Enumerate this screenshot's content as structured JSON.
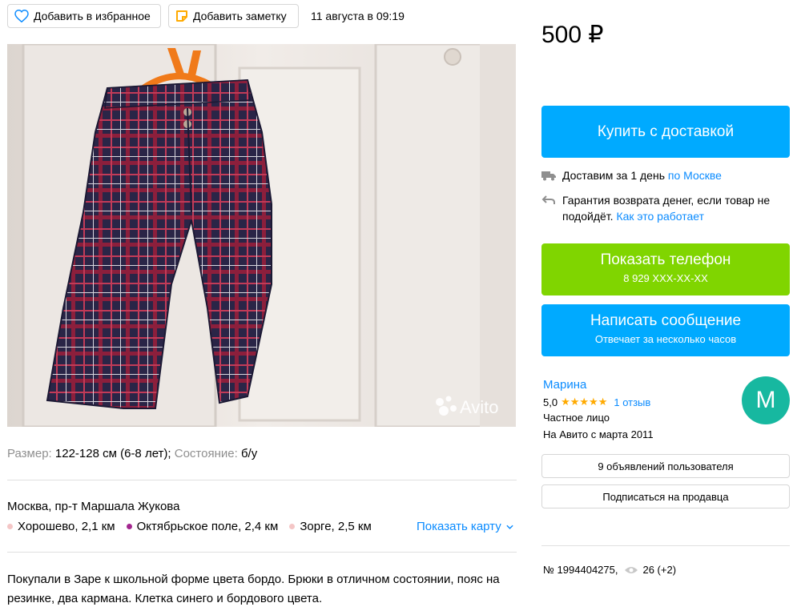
{
  "top_bar": {
    "favorite_label": "Добавить в избранное",
    "note_label": "Добавить заметку",
    "date": "11 августа в 09:19"
  },
  "photo": {
    "watermark": "Avito"
  },
  "details": {
    "size_label": "Размер:",
    "size_value": "122-128 см (6-8 лет);",
    "condition_label": "Состояние:",
    "condition_value": "б/у"
  },
  "location": {
    "address": "Москва, пр-т Маршала Жукова",
    "stations": [
      {
        "name": "Хорошево, 2,1 км",
        "color": "#f4c6c6"
      },
      {
        "name": "Октябрьское поле, 2,4 км",
        "color": "#a3268f"
      },
      {
        "name": "Зорге, 2,5 км",
        "color": "#f4c6c6"
      }
    ],
    "show_map": "Показать карту"
  },
  "description": "Покупали в Заре к школьной форме цвета бордо. Брюки в отличном состоянии, пояс на резинке, два кармана. Клетка синего и бордового цвета.",
  "price": "500 ₽",
  "buy": {
    "label": "Купить с доставкой"
  },
  "delivery": {
    "text": "Доставим за 1 день",
    "link": "по Москве"
  },
  "guarantee": {
    "text": "Гарантия возврата денег, если товар не подойдёт.",
    "link": "Как это работает"
  },
  "phone": {
    "label": "Показать телефон",
    "number": "8 929 XXX-XX-XX"
  },
  "message": {
    "label": "Написать сообщение",
    "sub": "Отвечает за несколько часов"
  },
  "seller": {
    "name": "Марина",
    "rating": "5,0",
    "stars": "★★★★★",
    "reviews": "1 отзыв",
    "type": "Частное лицо",
    "since": "На Авито с марта 2011",
    "avatar_letter": "М"
  },
  "seller_buttons": {
    "ads": "9 объявлений пользователя",
    "subscribe": "Подписаться на продавца"
  },
  "stats": {
    "id": "№ 1994404275,",
    "views": "26 (+2)"
  },
  "colors": {
    "accent_blue": "#00aaff",
    "link_blue": "#0a8bff",
    "phone_green": "#80d500",
    "avatar": "#17b8a0",
    "star": "#ffaa00"
  }
}
